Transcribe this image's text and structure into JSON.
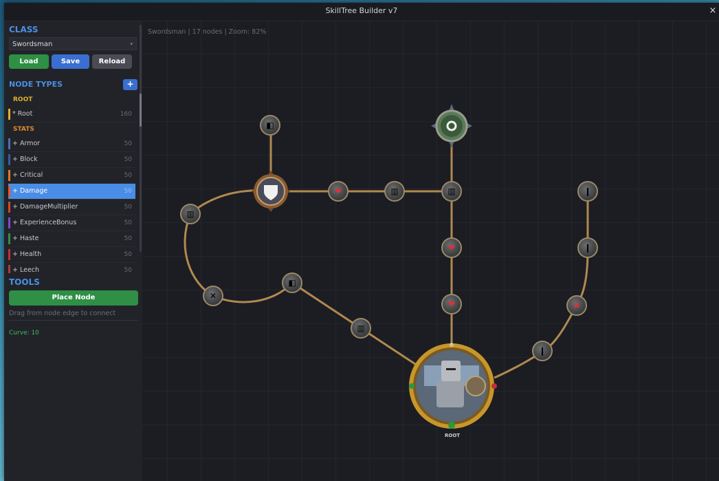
{
  "window": {
    "title": "SkillTree Builder v7",
    "close_glyph": "×"
  },
  "sidebar": {
    "class_heading": "CLASS",
    "class_select": {
      "value": "Swordsman",
      "chevron": "▾"
    },
    "buttons": {
      "load": "Load",
      "save": "Save",
      "reload": "Reload"
    },
    "node_types_heading": "NODE TYPES",
    "add_glyph": "+",
    "groups": {
      "root": {
        "label": "ROOT",
        "items": [
          {
            "label": "* Root",
            "count": "160",
            "color": "#e0b02a"
          }
        ]
      },
      "stats": {
        "label": "STATS",
        "items": [
          {
            "label": "+ Armor",
            "count": "50",
            "color": "#4a6fb5"
          },
          {
            "label": "+ Block",
            "count": "50",
            "color": "#3a5aa0"
          },
          {
            "label": "+ Critical",
            "count": "50",
            "color": "#e07a2a"
          },
          {
            "label": "+ Damage",
            "count": "50",
            "color": "#e05a2a"
          },
          {
            "label": "+ DamageMultiplier",
            "count": "50",
            "color": "#d04a2a"
          },
          {
            "label": "+ ExperienceBonus",
            "count": "50",
            "color": "#7a4ad0"
          },
          {
            "label": "+ Haste",
            "count": "50",
            "color": "#3a8a4a"
          },
          {
            "label": "+ Health",
            "count": "50",
            "color": "#c0303a"
          },
          {
            "label": "+ Leech",
            "count": "50",
            "color": "#b03a3a"
          }
        ]
      }
    },
    "tools_heading": "TOOLS",
    "place_node": "Place Node",
    "hint": "Drag from node edge to connect",
    "curve": "Curve: 10"
  },
  "canvas": {
    "status": "Swordsman | 17 nodes | Zoom: 82%",
    "root_label": "ROOT"
  },
  "colors": {
    "accent": "#4a90e2",
    "selected": "#4a8de6",
    "edge": "#b08a50",
    "green": "#2e8f45"
  }
}
